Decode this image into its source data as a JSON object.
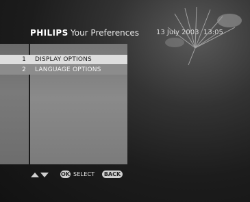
{
  "header": {
    "brand": "PHILIPS",
    "title": "Your Preferences",
    "date": "13 July 2003",
    "time": "13:05"
  },
  "menu": {
    "items": [
      {
        "number": "1",
        "label": "DISPLAY OPTIONS",
        "selected": true
      },
      {
        "number": "2",
        "label": "LANGUAGE OPTIONS",
        "selected": false
      }
    ]
  },
  "footer": {
    "ok_key": "OK",
    "select_label": "SELECT",
    "back_key": "BACK",
    "navigate_icon": "up-down-arrows-icon"
  },
  "colors": {
    "selected_row": "#dedede",
    "panel": "#7a7a7a",
    "background": "#141414"
  }
}
